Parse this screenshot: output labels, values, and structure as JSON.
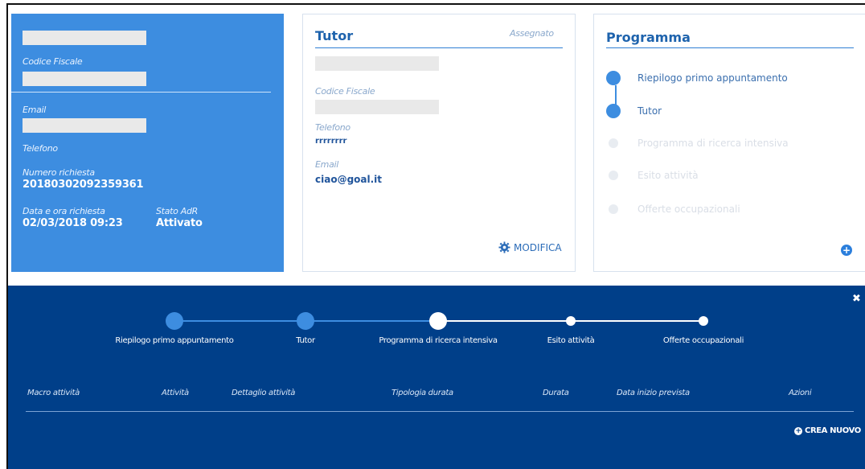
{
  "profile": {
    "codice_fiscale_label": "Codice Fiscale",
    "email_label": "Email",
    "telefono_label": "Telefono",
    "numero_richiesta_label": "Numero richiesta",
    "numero_richiesta_value": "20180302092359361",
    "data_ora_label": "Data e ora richiesta",
    "data_ora_value": "02/03/2018 09:23",
    "stato_label": "Stato AdR",
    "stato_value": "Attivato"
  },
  "tutor": {
    "title": "Tutor",
    "status": "Assegnato",
    "codice_fiscale_label": "Codice Fiscale",
    "telefono_label": "Telefono",
    "telefono_value": "rrrrrrrr",
    "email_label": "Email",
    "email_value": "ciao@goal.it",
    "modifica_label": "MODIFICA",
    "modifica_icon": "gear-icon"
  },
  "programma": {
    "title": "Programma",
    "steps": [
      {
        "label": "Riepilogo primo appuntamento",
        "active": true
      },
      {
        "label": "Tutor",
        "active": true
      },
      {
        "label": "Programma di ricerca intensiva",
        "active": false
      },
      {
        "label": "Esito attività",
        "active": false
      },
      {
        "label": "Offerte occupazionali",
        "active": false
      }
    ],
    "add_icon": "plus-circle-icon"
  },
  "panel": {
    "close_icon": "close-icon",
    "progress": [
      {
        "label": "Riepilogo primo appuntamento",
        "state": "done"
      },
      {
        "label": "Tutor",
        "state": "done"
      },
      {
        "label": "Programma di ricerca intensiva",
        "state": "current"
      },
      {
        "label": "Esito attività",
        "state": "todo"
      },
      {
        "label": "Offerte occupazionali",
        "state": "todo"
      }
    ],
    "columns": [
      "Macro attività",
      "Attività",
      "Dettaglio attività",
      "Tipologia durata",
      "Durata",
      "Data inizio prevista",
      "Azioni"
    ],
    "crea_nuovo_label": "CREA NUOVO"
  },
  "colors": {
    "accent_blue": "#3d8de0",
    "panel_navy": "#003f89"
  }
}
